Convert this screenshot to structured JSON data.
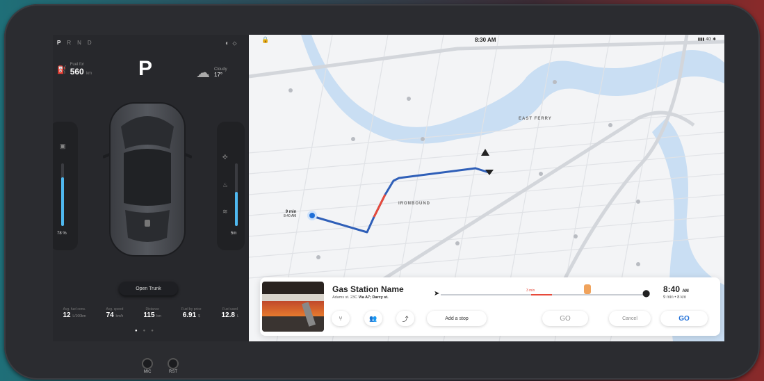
{
  "left": {
    "gears": [
      "P",
      "R",
      "N",
      "D"
    ],
    "active_gear": "P",
    "fuel": {
      "label": "Fuel for",
      "value": "560",
      "unit": "km"
    },
    "weather": {
      "label": "Cloudy",
      "value": "17°"
    },
    "battery_level": {
      "value": "78 %",
      "fraction": 0.78
    },
    "right_level": {
      "value": "5m",
      "fraction": 0.55
    },
    "open_trunk_label": "Open Trunk",
    "stats": [
      {
        "label": "Avg. fuel cons.",
        "value": "12",
        "unit": "L/100km"
      },
      {
        "label": "Avg. speed",
        "value": "74",
        "unit": "km/h"
      },
      {
        "label": "Distance",
        "value": "115",
        "unit": "km"
      },
      {
        "label": "Fuel by price",
        "value": "6.91",
        "unit": "$"
      },
      {
        "label": "Fuel used",
        "value": "12.8",
        "unit": "L"
      }
    ]
  },
  "map": {
    "time": "8:30 AM",
    "signal": "4G",
    "neighborhoods": [
      "EAST FERRY",
      "IRONBOUND"
    ],
    "start_eta": {
      "time": "9 min",
      "sub": "8:40 AM"
    }
  },
  "destination": {
    "name": "Gas Station Name",
    "address": "Adams st. 23C",
    "via": "Via A7; Darcy st.",
    "delay": "3 min",
    "arrival_time": "8:40",
    "arrival_suffix": "AM",
    "duration": "9 min",
    "distance": "8 km"
  },
  "actions": {
    "add_stop": "Add a stop",
    "go_secondary": "GO",
    "cancel": "Cancel",
    "go_primary": "GO"
  },
  "hardware": {
    "mic": "MIC",
    "rst": "RST"
  },
  "colors": {
    "accent": "#1f6fd8",
    "route": "#2f5fb8",
    "alert": "#e74a3b",
    "level": "#4fb8ef"
  }
}
